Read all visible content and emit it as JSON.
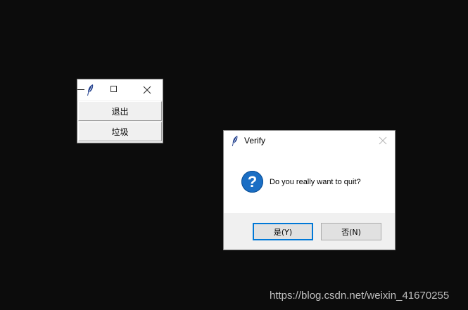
{
  "tk_window": {
    "buttons": [
      {
        "label": "退出"
      },
      {
        "label": "垃圾"
      }
    ]
  },
  "dialog": {
    "title": "Verify",
    "message": "Do you really want to quit?",
    "icon": "question-icon",
    "yes_label": "是(Y)",
    "no_label": "否(N)"
  },
  "watermark": "https://blog.csdn.net/weixin_41670255",
  "colors": {
    "desktop": "#0c0c0c",
    "accent": "#0078d7",
    "question_icon": "#1a6ec4"
  }
}
